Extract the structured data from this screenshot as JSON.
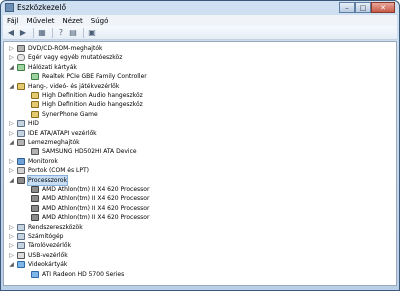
{
  "window": {
    "title": "Eszközkezelő"
  },
  "menu": [
    "Fájl",
    "Művelet",
    "Nézet",
    "Súgó"
  ],
  "toolbar": [
    "back-icon",
    "forward-icon",
    "sep",
    "properties-icon",
    "sep",
    "help-icon",
    "view-icon",
    "sep",
    "computer-icon"
  ],
  "tree": [
    {
      "level": 1,
      "expand": "collapsed",
      "icon": "dvd-drive-icon",
      "label": "DVD/CD-ROM-meghajtók"
    },
    {
      "level": 1,
      "expand": "collapsed",
      "icon": "mouse-icon",
      "label": "Egér vagy egyéb mutatóeszköz"
    },
    {
      "level": 1,
      "expand": "expanded",
      "icon": "network-adapter-icon",
      "label": "Hálózati kártyák"
    },
    {
      "level": 2,
      "expand": "none",
      "icon": "network-card-icon",
      "label": "Realtek PCIe GBE Family Controller"
    },
    {
      "level": 1,
      "expand": "expanded",
      "icon": "sound-icon",
      "label": "Hang-, videó- és játékvezérlők"
    },
    {
      "level": 2,
      "expand": "none",
      "icon": "audio-device-icon",
      "label": "High Definition Audio hangeszköz"
    },
    {
      "level": 2,
      "expand": "none",
      "icon": "audio-device-icon",
      "label": "High Definition Audio hangeszköz"
    },
    {
      "level": 2,
      "expand": "none",
      "icon": "audio-device-icon",
      "label": "SynerPhone Game"
    },
    {
      "level": 1,
      "expand": "collapsed",
      "icon": "hid-icon",
      "label": "HID"
    },
    {
      "level": 1,
      "expand": "collapsed",
      "icon": "ide-controller-icon",
      "label": "IDE ATA/ATAPI vezérlők"
    },
    {
      "level": 1,
      "expand": "expanded",
      "icon": "disk-drives-icon",
      "label": "Lemezmeghajtók"
    },
    {
      "level": 2,
      "expand": "none",
      "icon": "disk-icon",
      "label": "SAMSUNG HD502HI ATA Device"
    },
    {
      "level": 1,
      "expand": "collapsed",
      "icon": "monitor-icon",
      "label": "Monitorok"
    },
    {
      "level": 1,
      "expand": "collapsed",
      "icon": "port-icon",
      "label": "Portok (COM és LPT)"
    },
    {
      "level": 1,
      "expand": "expanded",
      "icon": "processor-icon",
      "label": "Processzorok",
      "selected": true
    },
    {
      "level": 2,
      "expand": "none",
      "icon": "cpu-icon",
      "label": "AMD Athlon(tm) II X4 620 Processor"
    },
    {
      "level": 2,
      "expand": "none",
      "icon": "cpu-icon",
      "label": "AMD Athlon(tm) II X4 620 Processor"
    },
    {
      "level": 2,
      "expand": "none",
      "icon": "cpu-icon",
      "label": "AMD Athlon(tm) II X4 620 Processor"
    },
    {
      "level": 2,
      "expand": "none",
      "icon": "cpu-icon",
      "label": "AMD Athlon(tm) II X4 620 Processor"
    },
    {
      "level": 1,
      "expand": "collapsed",
      "icon": "system-devices-icon",
      "label": "Rendszereszközök"
    },
    {
      "level": 1,
      "expand": "collapsed",
      "icon": "computer-icon",
      "label": "Számítógép"
    },
    {
      "level": 1,
      "expand": "collapsed",
      "icon": "storage-controller-icon",
      "label": "Tárolóvezérlők"
    },
    {
      "level": 1,
      "expand": "collapsed",
      "icon": "usb-icon",
      "label": "USB-vezérlők"
    },
    {
      "level": 1,
      "expand": "expanded",
      "icon": "display-adapter-icon",
      "label": "Videokártyák"
    },
    {
      "level": 2,
      "expand": "none",
      "icon": "video-card-icon",
      "label": "ATI Radeon HD 5700 Series"
    }
  ]
}
